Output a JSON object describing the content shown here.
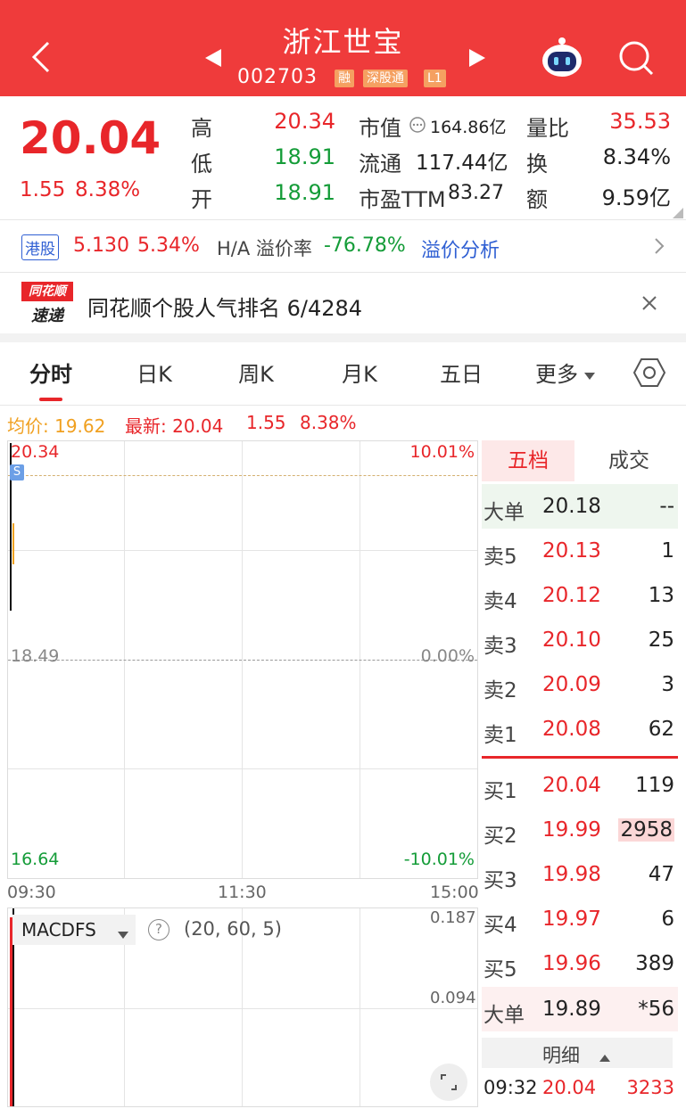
{
  "header": {
    "name": "浙江世宝",
    "code": "002703",
    "badges": [
      "融",
      "深股通",
      "L1"
    ]
  },
  "quote": {
    "price": "20.04",
    "change": "1.55",
    "change_pct": "8.38%",
    "high_label": "高",
    "high": "20.34",
    "low_label": "低",
    "low": "18.91",
    "open_label": "开",
    "open": "18.91",
    "mktcap_label": "市值",
    "mktcap": "164.86亿",
    "float_label": "流通",
    "float": "117.44亿",
    "pe_label": "市盈TTM",
    "pe": "83.27",
    "vol_ratio_label": "量比",
    "vol_ratio": "35.53",
    "turnover_label": "换",
    "turnover": "8.34%",
    "amount_label": "额",
    "amount": "9.59亿"
  },
  "hk": {
    "tag": "港股",
    "price": "5.130",
    "pct": "5.34%",
    "premium_label": "H/A 溢价率",
    "premium": "-76.78%",
    "analysis": "溢价分析"
  },
  "notice": {
    "logo_top": "同花顺",
    "logo_bottom": "速递",
    "text": "同花顺个股人气排名 6/4284"
  },
  "tabs": [
    "分时",
    "日K",
    "周K",
    "月K",
    "五日",
    "更多"
  ],
  "chart": {
    "avg_label": "均价: 19.62",
    "latest_label": "最新: 20.04",
    "latest_chg": "1.55",
    "latest_pct": "8.38%",
    "y_top": "20.34",
    "y_mid": "18.49",
    "y_bot": "16.64",
    "pct_top": "10.01%",
    "pct_mid": "0.00%",
    "pct_bot": "-10.01%",
    "s_marker": "S",
    "t_start": "09:30",
    "t_mid": "11:30",
    "t_end": "15:00"
  },
  "macd": {
    "selector": "MACDFS",
    "help": "?",
    "params": "(20, 60, 5)",
    "y_top": "0.187",
    "y_mid": "0.094"
  },
  "orderbook": {
    "tab_active": "五档",
    "tab_other": "成交",
    "big_sell": {
      "label": "大单",
      "price": "20.18",
      "vol": "--"
    },
    "asks": [
      {
        "label": "卖5",
        "price": "20.13",
        "vol": "1"
      },
      {
        "label": "卖4",
        "price": "20.12",
        "vol": "13"
      },
      {
        "label": "卖3",
        "price": "20.10",
        "vol": "25"
      },
      {
        "label": "卖2",
        "price": "20.09",
        "vol": "3"
      },
      {
        "label": "卖1",
        "price": "20.08",
        "vol": "62"
      }
    ],
    "bids": [
      {
        "label": "买1",
        "price": "20.04",
        "vol": "119"
      },
      {
        "label": "买2",
        "price": "19.99",
        "vol": "2958"
      },
      {
        "label": "买3",
        "price": "19.98",
        "vol": "47"
      },
      {
        "label": "买4",
        "price": "19.97",
        "vol": "6"
      },
      {
        "label": "买5",
        "price": "19.96",
        "vol": "389"
      }
    ],
    "big_buy": {
      "label": "大单",
      "price": "19.89",
      "vol": "*56"
    },
    "detail_label": "明细",
    "last_trade": {
      "time": "09:32",
      "price": "20.04",
      "vol": "3233"
    }
  },
  "colors": {
    "brand": "#ef3b3b",
    "up": "#e8262a",
    "down": "#149c38",
    "link": "#2f5fd3",
    "avg_line": "#f0a020"
  }
}
